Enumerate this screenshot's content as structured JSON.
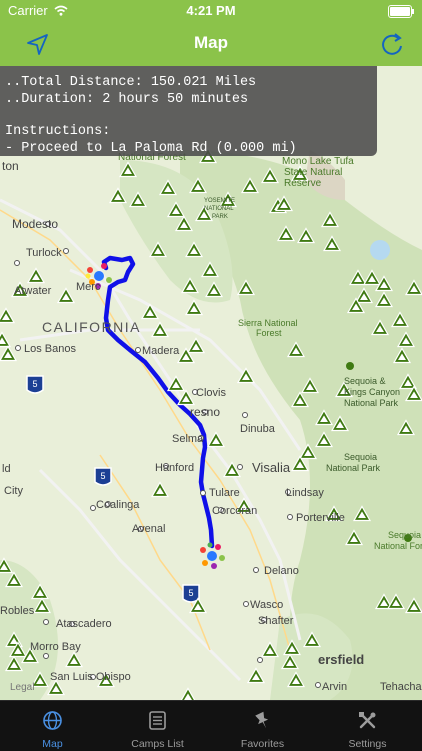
{
  "status_bar": {
    "carrier": "Carrier",
    "time": "4:21 PM"
  },
  "nav": {
    "title": "Map",
    "left_icon": "location-arrow-icon",
    "right_icon": "refresh-icon"
  },
  "info": {
    "distance": "..Total Distance: 150.021 Miles",
    "duration": "..Duration: 2 hours 50 minutes",
    "instructions_label": "Instructions:",
    "instruction_1": "- Proceed to La Paloma Rd (0.000 mi)"
  },
  "map": {
    "labels": {
      "ton": "ton",
      "modesto": "Modesto",
      "turlock": "Turlock",
      "atwater": "Atwater",
      "merced": "Merc",
      "california": "CALIFORNIA",
      "los_banos": "Los Banos",
      "madera": "Madera",
      "clovis": "Clovis",
      "fresno": "resno",
      "selma": "Selma",
      "dinuba": "Dinuba",
      "hanford": "Hanford",
      "visalia": "Visalia",
      "tulare": "Tulare",
      "lindsay": "Lindsay",
      "coalinga": "Coalinga",
      "ld": "ld",
      "city": "City",
      "avenal": "Avenal",
      "porterville": "Porterville",
      "corcoran": "Corcoran",
      "delano": "Delano",
      "wasco": "Wasco",
      "robles": "Robles",
      "atascadero": "Atascadero",
      "shafter": "Shafter",
      "morro_bay": "Morro Bay",
      "bakersfield": "ersfield",
      "slo": "San Luis Obispo",
      "arvin": "Arvin",
      "tehacha": "Tehacha",
      "legal": "Legal",
      "forest_top": "National Forest",
      "mono_lake": "Mono Lake Tufa",
      "state_nat": "State Natural",
      "reserve": "Reserve",
      "yosemite_1": "YOSEMITE",
      "yosemite_2": "NATIONAL",
      "yosemite_3": "PARK",
      "sierra_1": "Sierra National",
      "sierra_2": "Forest",
      "sequoia_1": "Sequoia &",
      "sequoia_2": "Kings Canyon",
      "sequoia_3": "National Park",
      "sequoia_nf_1": "Sequoia",
      "sequoia_nf_2": "National Park",
      "seq_forest_1": "Sequoia",
      "seq_forest_2": "National Fore",
      "hwy5_a": "5",
      "hwy5_b": "5",
      "hwy5_c": "5"
    }
  },
  "tabs": [
    {
      "label": "Map",
      "icon": "globe-icon",
      "active": true
    },
    {
      "label": "Camps List",
      "icon": "list-icon",
      "active": false
    },
    {
      "label": "Favorites",
      "icon": "pin-icon",
      "active": false
    },
    {
      "label": "Settings",
      "icon": "tools-icon",
      "active": false
    }
  ],
  "colors": {
    "accent_green": "#8bc34a",
    "route_blue": "#1010e8",
    "tab_active": "#4a90e2",
    "camp_marker": "#3f7a12"
  }
}
